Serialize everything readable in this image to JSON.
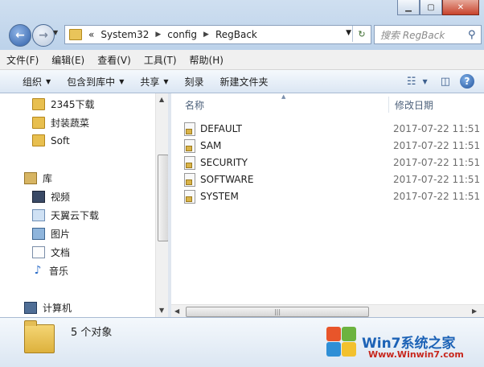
{
  "address": {
    "overflow": "«",
    "crumbs": [
      "System32",
      "config",
      "RegBack"
    ]
  },
  "search": {
    "placeholder": "搜索 RegBack"
  },
  "menu": [
    "文件(F)",
    "编辑(E)",
    "查看(V)",
    "工具(T)",
    "帮助(H)"
  ],
  "toolbar": {
    "organize": "组织",
    "include_in_library": "包含到库中",
    "share": "共享",
    "burn": "刻录",
    "new_folder": "新建文件夹"
  },
  "nav": {
    "favorites_folders": [
      "2345下载",
      "封装蔬菜",
      "Soft"
    ],
    "libraries_label": "库",
    "libraries": [
      "视频",
      "天翼云下载",
      "图片",
      "文档",
      "音乐"
    ],
    "computer_label": "计算机"
  },
  "columns": {
    "name": "名称",
    "modified": "修改日期"
  },
  "files": [
    {
      "name": "DEFAULT",
      "modified": "2017-07-22 11:51"
    },
    {
      "name": "SAM",
      "modified": "2017-07-22 11:51"
    },
    {
      "name": "SECURITY",
      "modified": "2017-07-22 11:51"
    },
    {
      "name": "SOFTWARE",
      "modified": "2017-07-22 11:51"
    },
    {
      "name": "SYSTEM",
      "modified": "2017-07-22 11:51"
    }
  ],
  "details": {
    "count_label": "5 个对象"
  },
  "watermark": {
    "title": "Win7系统之家",
    "url": "Www.Winwin7.com"
  }
}
